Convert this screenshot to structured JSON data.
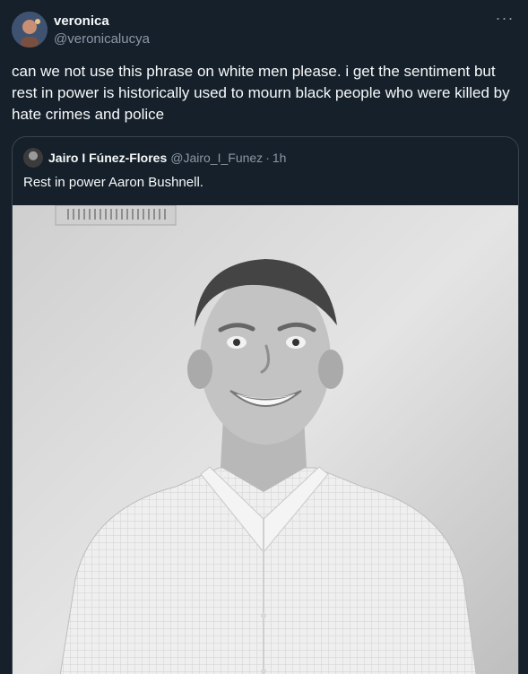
{
  "tweet": {
    "author": {
      "display_name": "veronica",
      "handle": "@veronicalucya",
      "avatar_icon": "profile-photo"
    },
    "more_label": "···",
    "text": "can we not use this phrase on white men please. i get the sentiment but rest in power is historically used to mourn black people who were killed by hate crimes and police"
  },
  "quote": {
    "author": {
      "display_name": "Jairo I Fúnez-Flores",
      "handle": "@Jairo_I_Funez",
      "separator": "·",
      "time": "1h"
    },
    "text": "Rest in power Aaron Bushnell.",
    "media": {
      "type": "photo",
      "colors": {
        "wall": "#d9d9d9",
        "shirt": "#f0f0f0",
        "skin": "#b8b8b8",
        "hair": "#3f3f3f"
      }
    }
  },
  "colors": {
    "background": "#15202b",
    "text_primary": "#f7f9f9",
    "text_secondary": "#8b98a5",
    "border": "#38444d"
  }
}
